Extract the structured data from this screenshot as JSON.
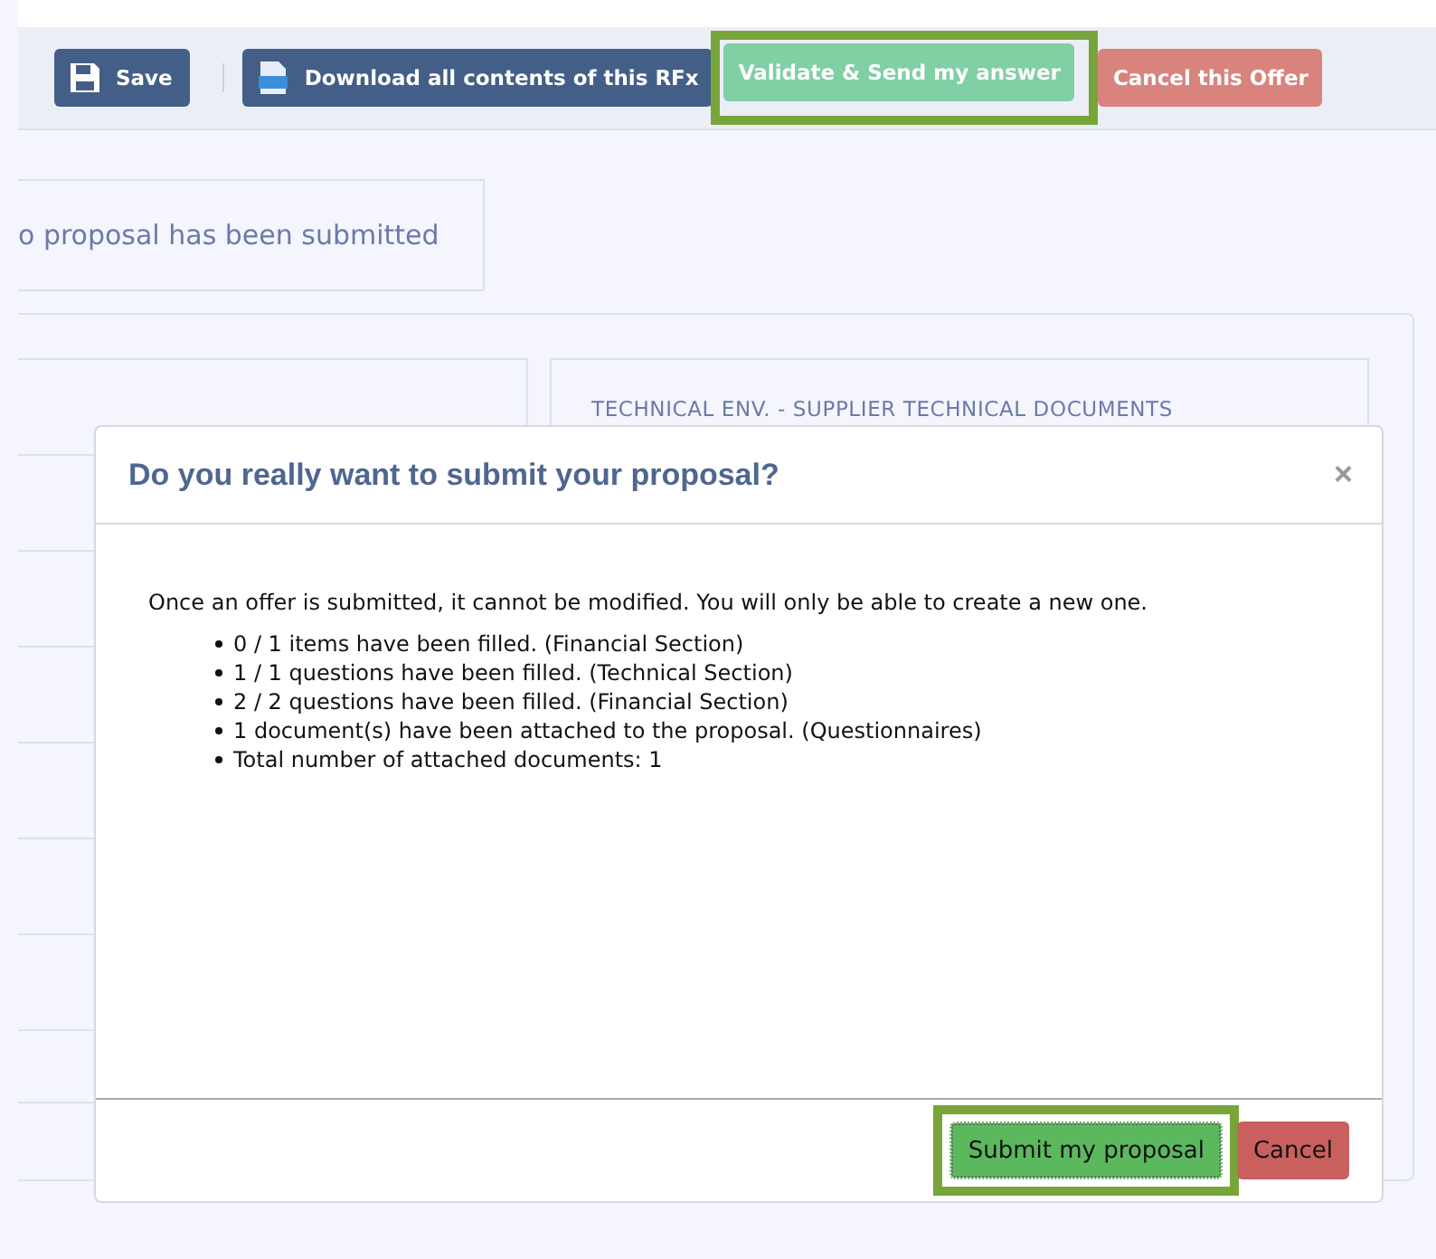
{
  "toolbar": {
    "buttons": [
      {
        "label": "Save",
        "kind": "save",
        "highlighted": false
      },
      {
        "label": "Download all contents of this RFx",
        "kind": "download",
        "highlighted": false
      },
      {
        "label": "Validate & Send my answer",
        "kind": "validate",
        "highlighted": true
      },
      {
        "label": "Cancel this Offer",
        "kind": "cancel",
        "highlighted": false
      }
    ]
  },
  "notice": {
    "text": "o proposal has been submitted"
  },
  "right_card": {
    "title": "TECHNICAL ENV. - SUPPLIER TECHNICAL DOCUMENTS"
  },
  "dialog": {
    "title": "Do you really want to submit your proposal?",
    "close": "×",
    "message": "Once an offer is submitted, it cannot be modified. You will only be able to create a new one.",
    "items": [
      "0 / 1 items have been filled. (Financial Section)",
      "1 / 1 questions have been filled. (Technical Section)",
      "2 / 2 questions have been filled. (Financial Section)",
      "1 document(s) have been attached to the proposal. (Questionnaires)",
      "Total number of attached documents: 1"
    ],
    "buttons": [
      {
        "label": "Submit my proposal",
        "kind": "submit",
        "highlighted": true
      },
      {
        "label": "Cancel",
        "kind": "cancel",
        "highlighted": false
      }
    ]
  }
}
